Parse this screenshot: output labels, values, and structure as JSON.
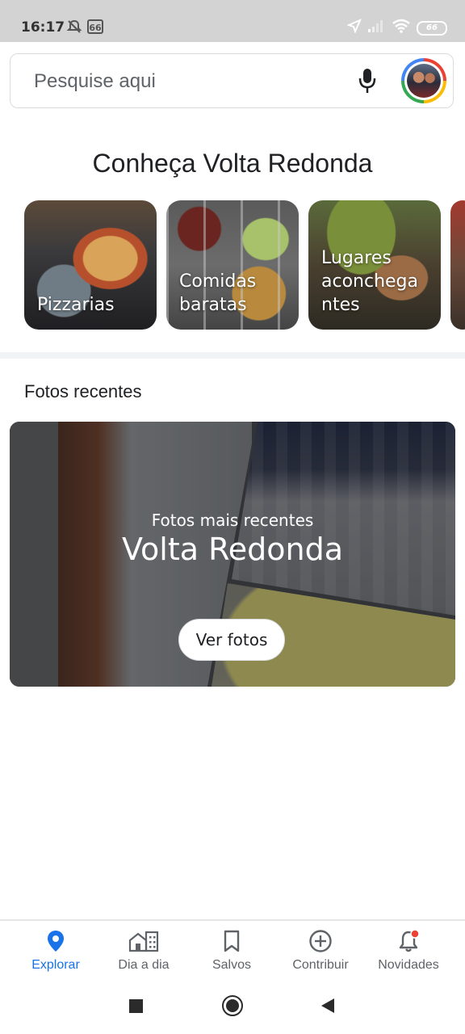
{
  "status_bar": {
    "time": "16:17",
    "notif_badge": "66",
    "battery": "66"
  },
  "search": {
    "placeholder": "Pesquise aqui"
  },
  "explore": {
    "title": "Conheça Volta Redonda",
    "categories": [
      {
        "label": "Pizzarias"
      },
      {
        "label": "Comidas\nbaratas"
      },
      {
        "label": "Lugares\naconchega\nntes"
      }
    ]
  },
  "recent_photos": {
    "section_title": "Fotos recentes",
    "subtitle": "Fotos mais recentes",
    "place": "Volta Redonda",
    "button": "Ver fotos"
  },
  "bottom_nav": {
    "items": [
      {
        "label": "Explorar",
        "icon": "location-pin-icon",
        "active": true
      },
      {
        "label": "Dia a dia",
        "icon": "buildings-icon"
      },
      {
        "label": "Salvos",
        "icon": "bookmark-icon"
      },
      {
        "label": "Contribuir",
        "icon": "add-circle-icon"
      },
      {
        "label": "Novidades",
        "icon": "bell-icon"
      }
    ]
  },
  "colors": {
    "accent": "#1a73e8",
    "notification_dot": "#ea4335"
  }
}
